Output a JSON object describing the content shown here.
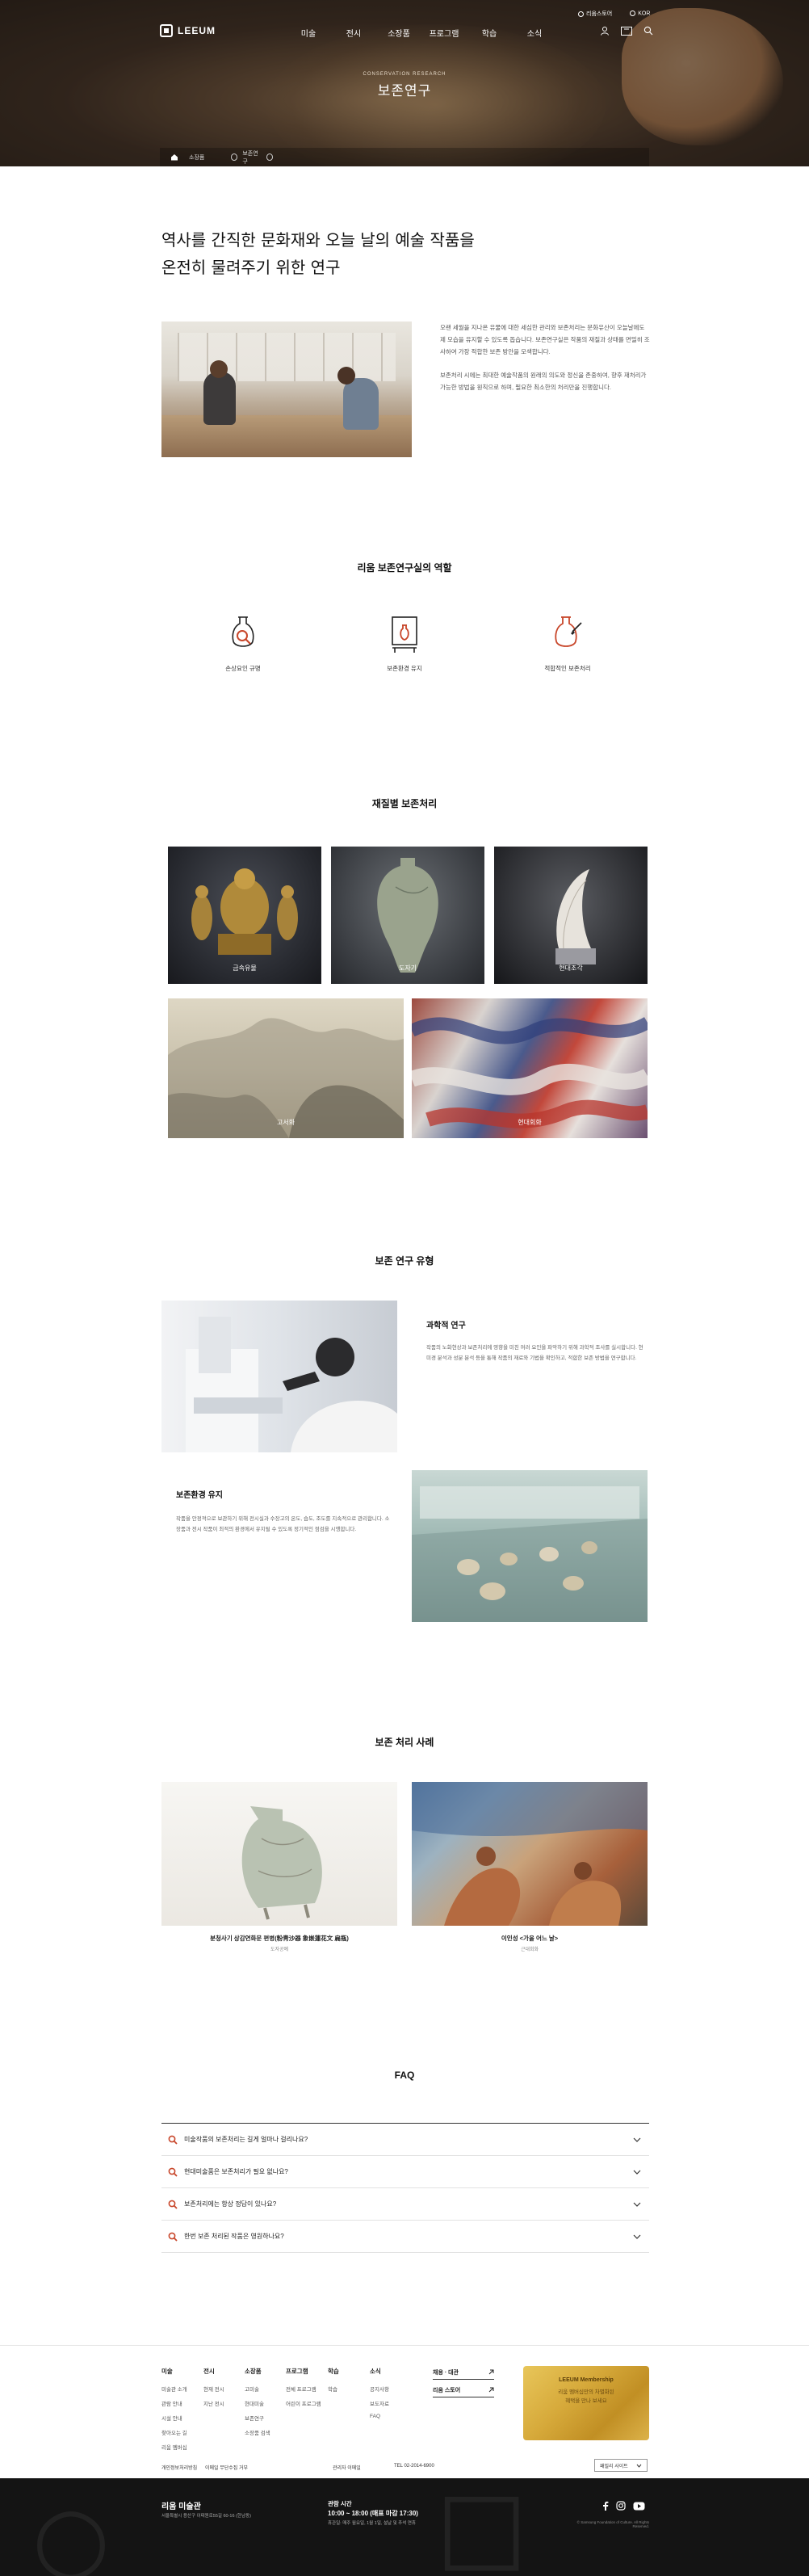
{
  "header": {
    "logo_text": "LEEUM",
    "nav": [
      "미술",
      "전시",
      "소장품",
      "프로그램",
      "학습",
      "소식"
    ],
    "util_links": [
      "리움스토어",
      "KOR"
    ],
    "icons": [
      "user-icon",
      "ticket-icon",
      "search-icon"
    ]
  },
  "hero": {
    "subtitle": "CONSERVATION RESEARCH",
    "title": "보존연구"
  },
  "breadcrumb": [
    "소장품",
    "보존연구"
  ],
  "intro": {
    "title_line1": "역사를 간직한 문화재와 오늘 날의 예술 작품을",
    "title_line2": "온전히 물려주기 위한 연구",
    "para1": "오랜 세월을 지나온 유물에 대한 세심한 관리와 보존처리는 문화유산이 오늘날에도 제 모습을 유지할 수 있도록 돕습니다. 보존연구실은 작품의 재질과 상태를 면밀히 조사하여 가장 적합한 보존 방안을 모색합니다.",
    "para2": "보존처리 시에는 최대한 예술작품의 원래의 의도와 정신을 존중하여, 향후 재처리가 가능한 방법을 원칙으로 하며, 필요한 최소한의 처리만을 진행합니다."
  },
  "roles": {
    "title": "리움 보존연구실의 역할",
    "items": [
      {
        "label": "손상요인 규명",
        "icon": "vase-search-icon"
      },
      {
        "label": "보존환경 유지",
        "icon": "display-case-icon"
      },
      {
        "label": "적합적인 보존처리",
        "icon": "vase-brush-icon"
      }
    ]
  },
  "materials": {
    "title": "재질별 보존처리",
    "items": [
      "금속유물",
      "도자기",
      "현대조각",
      "고서화",
      "현대회화"
    ]
  },
  "research": {
    "title": "보존 연구 유형",
    "items": [
      {
        "heading": "과학적 연구",
        "text": "작품의 노화현상과 보존처리에 영향을 미친 여러 요인을 파악하기 위해 과학적 조사를 실시합니다. 현미경 분석과 성분 분석 등을 통해 작품의 재료와 기법을 확인하고, 적합한 보존 방법을 연구합니다."
      },
      {
        "heading": "보존환경 유지",
        "text": "작품을 안정적으로 보관하기 위해 전시실과 수장고의 온도, 습도, 조도를 지속적으로 관리합니다. 소장품과 전시 작품이 최적의 환경에서 유지될 수 있도록 정기적인 점검을 시행합니다."
      }
    ]
  },
  "cases": {
    "title": "보존 처리 사례",
    "items": [
      {
        "title": "분청사기 상감연화문 편병(粉靑沙器 象嵌蓮花文 扁甁)",
        "sub": "도자공예"
      },
      {
        "title": "이인성 <가을 어느 날>",
        "sub": "근대회화"
      }
    ]
  },
  "faq": {
    "title": "FAQ",
    "items": [
      "미술작품의 보존처리는 길게 얼마나 걸리나요?",
      "현대미술품은 보존처리가 필요 없나요?",
      "보존처리에는 항상 정답이 있나요?",
      "한번 보존 처리된 작품은 영원하나요?"
    ]
  },
  "footer": {
    "columns": [
      {
        "heading": "미술",
        "items": [
          "미술관 소개",
          "관람 안내",
          "시설 안내",
          "찾아오는 길",
          "리움 멤버십"
        ]
      },
      {
        "heading": "전시",
        "items": [
          "현재 전시",
          "지난 전시"
        ]
      },
      {
        "heading": "소장품",
        "items": [
          "고미술",
          "현대미술",
          "보존연구",
          "소장품 검색"
        ]
      },
      {
        "heading": "프로그램",
        "items": [
          "전체 프로그램",
          "어린이 프로그램"
        ]
      },
      {
        "heading": "학습",
        "items": [
          "학습"
        ]
      },
      {
        "heading": "소식",
        "items": [
          "공지사항",
          "보도자료",
          "FAQ"
        ]
      }
    ],
    "buttons": [
      "채용 · 대관",
      "리움 스토어"
    ],
    "membership": {
      "title": "LEEUM Membership",
      "line1": "리움 멤버십만의 차별화된",
      "line2": "혜택을 만나 보세요"
    },
    "info": [
      "개인정보처리방침",
      "이메일 무단수집 거부",
      "관리자 이메일",
      "TEL 02-2014-6900"
    ],
    "family_site": "패밀리 사이트",
    "name": "리움 미술관",
    "address": "서울특별시 용산구 이태원로55길 60-16 (한남동)",
    "hours_label": "관람 시간",
    "hours": "10:00 ~ 18:00 (매표 마감 17:30)",
    "closed": "휴관일: 매주 월요일, 1월 1일, 설날 및 추석 연휴",
    "copyright": "© Samsung Foundation of Culture. All Rights Reserved.",
    "social_icons": [
      "facebook-icon",
      "instagram-icon",
      "youtube-icon"
    ]
  },
  "colors": {
    "accent": "#c8462a",
    "gold": "#d6a93a",
    "footer_dark": "#141414"
  }
}
